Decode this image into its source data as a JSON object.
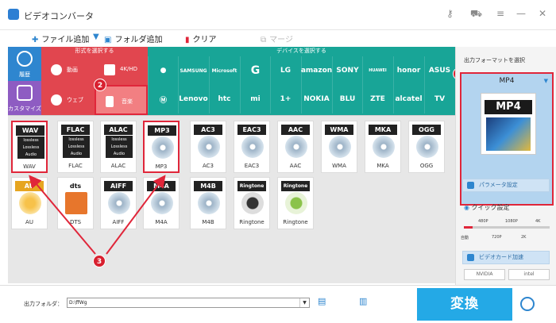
{
  "app": {
    "title": "ビデオコンバータ"
  },
  "toolbar": {
    "add_file": "ファイル追加",
    "add_folder": "フォルダ追加",
    "clear": "クリア",
    "merge": "マージ"
  },
  "side": {
    "recent": "履歴",
    "custom": "カスタマイズ"
  },
  "format_panel": {
    "header": "形式を選択する",
    "buttons": [
      "動画",
      "4K/HD",
      "ウェブ",
      "音楽"
    ]
  },
  "device_panel": {
    "header": "デバイスを選択する",
    "row1": [
      "",
      "SAMSUNG",
      "Microsoft",
      "G",
      "LG",
      "amazon",
      "SONY",
      "HUAWEI",
      "honor",
      "ASUS"
    ],
    "row2": [
      "",
      "Lenovo",
      "htc",
      "mi",
      "1+",
      "NOKIA",
      "BLU",
      "ZTE",
      "alcatel",
      "TV"
    ]
  },
  "formats": [
    {
      "tag": "WAV",
      "name": "WAV",
      "lossless": true
    },
    {
      "tag": "FLAC",
      "name": "FLAC",
      "lossless": true
    },
    {
      "tag": "ALAC",
      "name": "ALAC",
      "lossless": true
    },
    {
      "tag": "MP3",
      "name": "MP3",
      "lossless": false
    },
    {
      "tag": "AC3",
      "name": "AC3",
      "lossless": false
    },
    {
      "tag": "EAC3",
      "name": "EAC3",
      "lossless": false
    },
    {
      "tag": "AAC",
      "name": "AAC",
      "lossless": false
    },
    {
      "tag": "WMA",
      "name": "WMA",
      "lossless": false
    },
    {
      "tag": "MKA",
      "name": "MKA",
      "lossless": false
    },
    {
      "tag": "OGG",
      "name": "OGG",
      "lossless": false
    },
    {
      "tag": "AU",
      "name": "AU",
      "lossless": false
    },
    {
      "tag": "dts",
      "name": "DTS",
      "lossless": false
    },
    {
      "tag": "AIFF",
      "name": "AIFF",
      "lossless": false
    },
    {
      "tag": "M4A",
      "name": "M4A",
      "lossless": false
    },
    {
      "tag": "M4B",
      "name": "M4B",
      "lossless": false
    },
    {
      "tag": "Ringtone",
      "name": "Ringtone",
      "lossless": false
    },
    {
      "tag": "Ringtone",
      "name": "Ringtone",
      "lossless": false
    }
  ],
  "lossless_text": "lossless\nLossless\nAudio",
  "right": {
    "title": "出力フォーマットを選択",
    "format": "MP4",
    "caret": "▼",
    "params": "パラメータ設定",
    "quick": "クイック設定",
    "q_top": [
      "480P",
      "1080P",
      "4K"
    ],
    "q_bottom": [
      "自動",
      "720P",
      "2K"
    ],
    "gpu": "ビデオカード加速",
    "nvidia": "NVIDIA",
    "intel": "intel"
  },
  "bottom": {
    "out_label": "出力フォルダ：",
    "out_path": "D:\\ffWg",
    "convert": "変換"
  },
  "badges": [
    "1",
    "2",
    "3"
  ]
}
